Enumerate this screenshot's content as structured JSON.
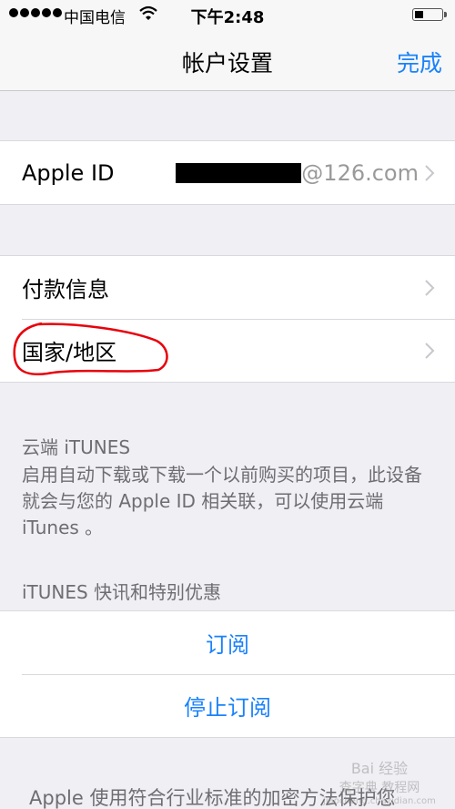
{
  "status_bar": {
    "signal_dots": 5,
    "carrier": "中国电信",
    "wifi_icon": "wifi-icon",
    "time": "下午2:48",
    "battery_level": 0.35
  },
  "nav": {
    "title": "帐户设置",
    "done_label": "完成"
  },
  "account_group": {
    "apple_id_label": "Apple ID",
    "apple_id_value_suffix": "@126.com",
    "apple_id_value_redacted": true
  },
  "payment_group": {
    "items": [
      {
        "label": "付款信息"
      },
      {
        "label": "国家/地区",
        "annotated": true
      }
    ]
  },
  "itunes_cloud": {
    "header": "云端 iTUNES",
    "description": "启用自动下载或下载一个以前购买的项目，此设备就会与您的 Apple ID 相关联，可以使用云端 iTunes 。"
  },
  "itunes_news": {
    "header": "iTUNES 快讯和特别优惠",
    "subscribe_label": "订阅",
    "unsubscribe_label": "停止订阅"
  },
  "footer": {
    "text": "Apple 使用符合行业标准的加密方法保护您"
  },
  "watermark": {
    "line1": "Bai 经验",
    "line2": "查字典 教程网",
    "line3": "jiaocheng.chazidian.com"
  },
  "colors": {
    "accent": "#1a82fb",
    "annotation": "#e8000b",
    "background": "#efeff4"
  }
}
